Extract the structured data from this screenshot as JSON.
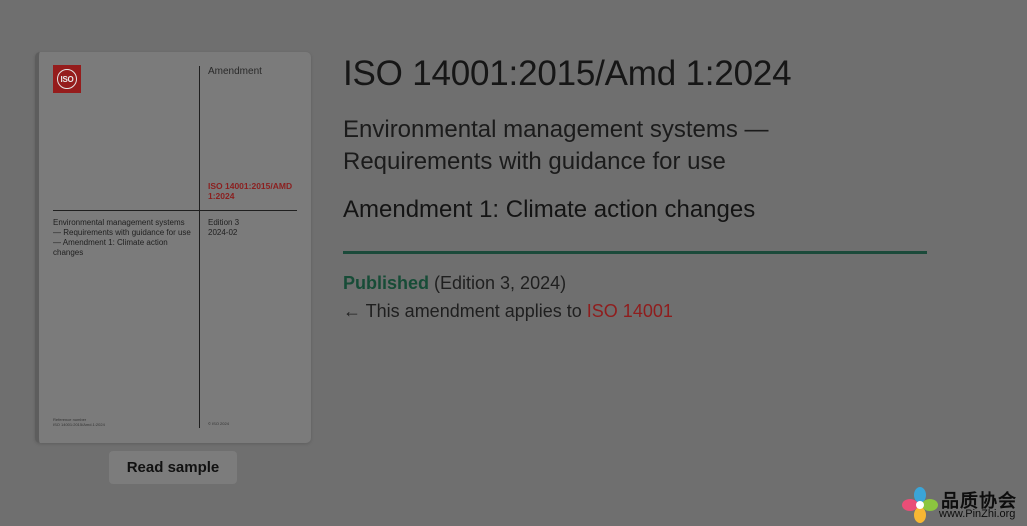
{
  "cover": {
    "logo_text": "ISO",
    "doc_type": "Amendment",
    "reference": "ISO 14001:2015/AMD 1:2024",
    "title": "Environmental management systems — Requirements with guidance for use — Amendment 1: Climate action changes",
    "edition_line1": "Edition 3",
    "edition_line2": "2024-02",
    "refnum_line1": "Reference number",
    "refnum_line2": "ISO 14001:2015/Amd.1:2024",
    "copyright": "© ISO 2024"
  },
  "read_sample_label": "Read sample",
  "standard": {
    "id": "ISO 14001:2015/Amd 1:2024",
    "title": "Environmental management systems — Requirements with guidance for use",
    "subtitle": "Amendment 1: Climate action changes",
    "status": "Published",
    "status_detail": " (Edition 3, 2024)",
    "applies_prefix": "← This amendment applies to ",
    "applies_link": "ISO 14001"
  },
  "colors": {
    "background": "#6f6f6f",
    "status_green": "#174c37",
    "link_red": "#8f1d1d",
    "divider": "#1b4a3a"
  },
  "watermark": {
    "chinese": "品质协会",
    "url": "www.PinZhi.org",
    "icon": "flower-logo-icon"
  }
}
